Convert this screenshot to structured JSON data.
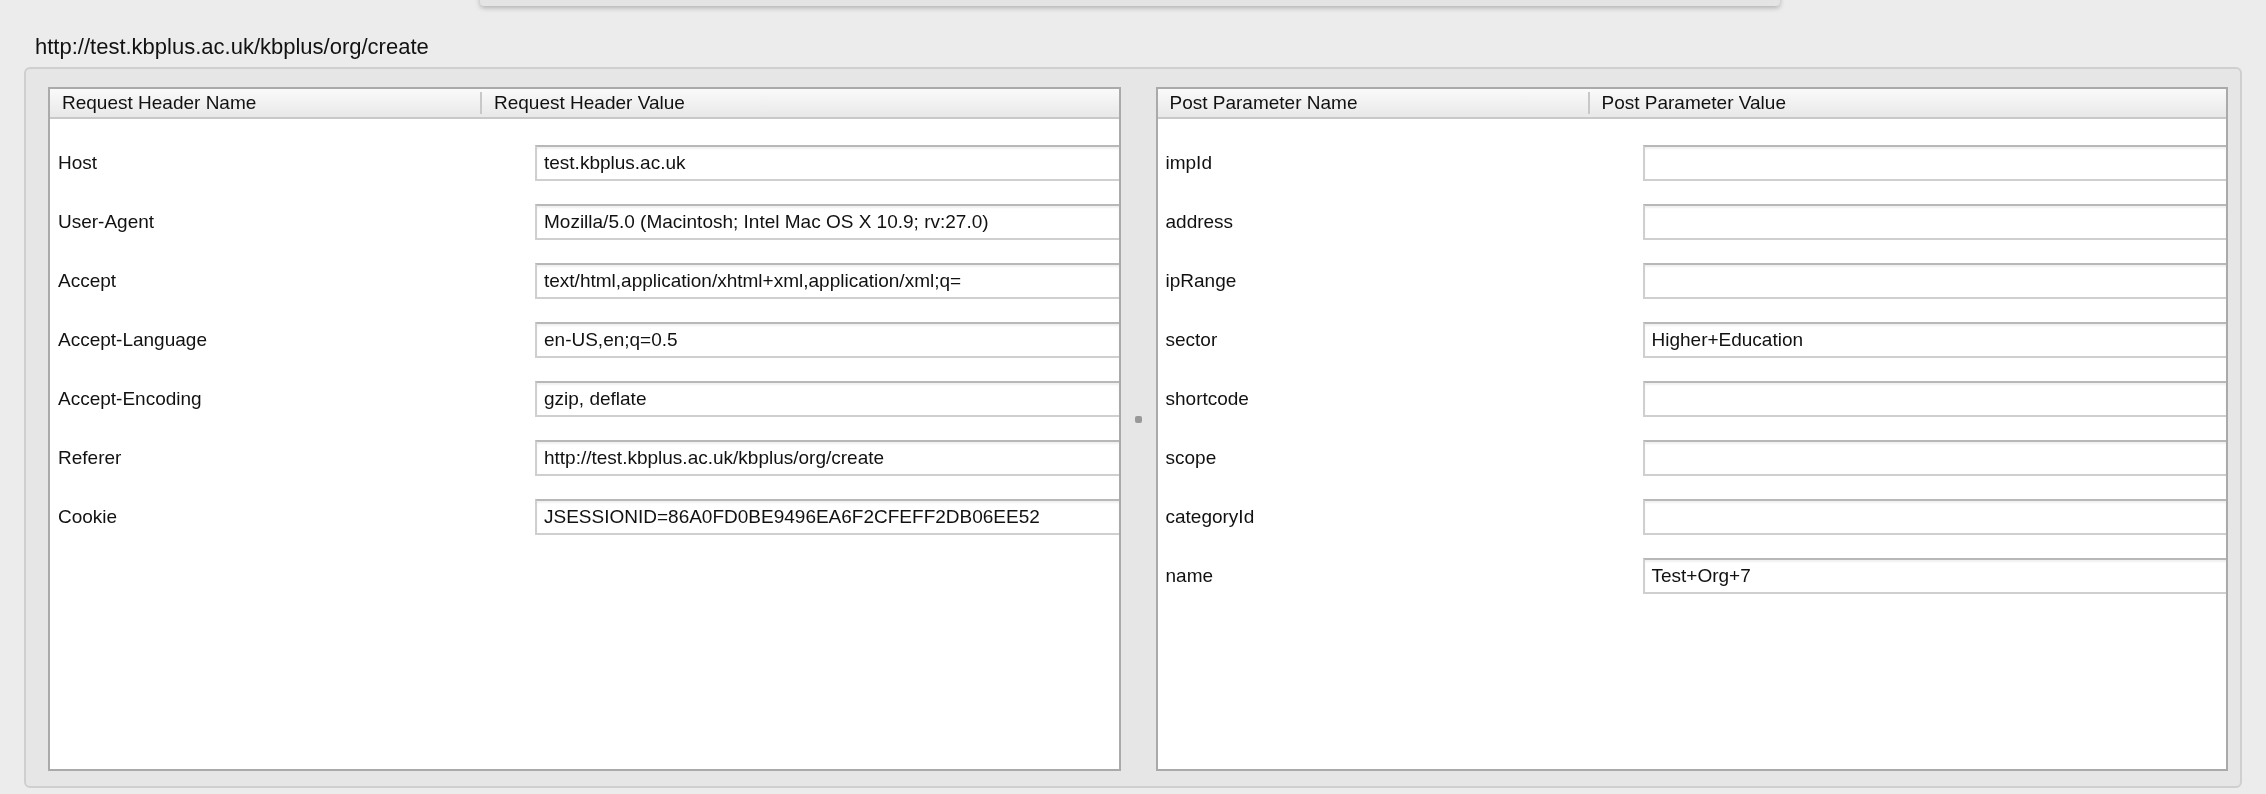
{
  "url_title": "http://test.kbplus.ac.uk/kbplus/org/create",
  "request_headers": {
    "columns": [
      "Request Header Name",
      "Request Header Value"
    ],
    "rows": [
      {
        "name": "Host",
        "value": "test.kbplus.ac.uk"
      },
      {
        "name": "User-Agent",
        "value": "Mozilla/5.0 (Macintosh; Intel Mac OS X 10.9; rv:27.0)"
      },
      {
        "name": "Accept",
        "value": "text/html,application/xhtml+xml,application/xml;q="
      },
      {
        "name": "Accept-Language",
        "value": "en-US,en;q=0.5"
      },
      {
        "name": "Accept-Encoding",
        "value": "gzip, deflate"
      },
      {
        "name": "Referer",
        "value": "http://test.kbplus.ac.uk/kbplus/org/create"
      },
      {
        "name": "Cookie",
        "value": "JSESSIONID=86A0FD0BE9496EA6F2CFEFF2DB06EE52"
      }
    ]
  },
  "post_parameters": {
    "columns": [
      "Post Parameter Name",
      "Post Parameter Value"
    ],
    "rows": [
      {
        "name": "impId"
      },
      {
        "name": "address"
      },
      {
        "name": "ipRange"
      },
      {
        "name": "sector",
        "value": "Higher+Education"
      },
      {
        "name": "shortcode"
      },
      {
        "name": "scope"
      },
      {
        "name": "categoryId"
      },
      {
        "name": "name",
        "value": "Test+Org+7"
      }
    ]
  }
}
